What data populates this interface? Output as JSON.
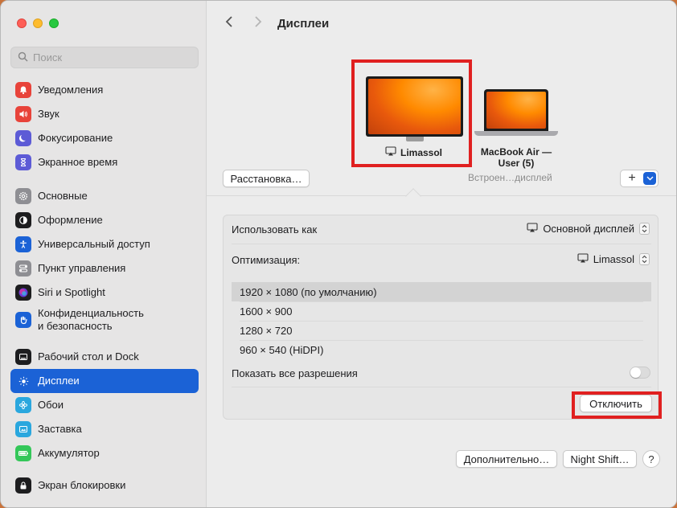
{
  "sidebar": {
    "search_placeholder": "Поиск",
    "groups": [
      [
        {
          "label": "Уведомления",
          "icon": "bell-icon",
          "color": "#e8433a"
        },
        {
          "label": "Звук",
          "icon": "speaker-icon",
          "color": "#e8433a"
        },
        {
          "label": "Фокусирование",
          "icon": "moon-icon",
          "color": "#5d5bd6"
        },
        {
          "label": "Экранное время",
          "icon": "hourglass-icon",
          "color": "#5d5bd6"
        }
      ],
      [
        {
          "label": "Основные",
          "icon": "gear-icon",
          "color": "#8e8e93"
        },
        {
          "label": "Оформление",
          "icon": "appearance-icon",
          "color": "#1d1d1f"
        },
        {
          "label": "Универсальный доступ",
          "icon": "accessibility-icon",
          "color": "#1b62d6"
        },
        {
          "label": "Пункт управления",
          "icon": "control-center-icon",
          "color": "#8e8e93"
        },
        {
          "label": "Siri и Spotlight",
          "icon": "siri-icon",
          "color": "#b03ad6"
        },
        {
          "label": "Конфиденциальность\nи безопасность",
          "icon": "hand-icon",
          "color": "#1b62d6"
        }
      ],
      [
        {
          "label": "Рабочий стол и Dock",
          "icon": "dock-icon",
          "color": "#1d1d1f"
        },
        {
          "label": "Дисплеи",
          "icon": "sun-icon",
          "color": "#1b62d6",
          "active": true
        },
        {
          "label": "Обои",
          "icon": "flower-icon",
          "color": "#2aa7de"
        },
        {
          "label": "Заставка",
          "icon": "screensaver-icon",
          "color": "#2aa7de"
        },
        {
          "label": "Аккумулятор",
          "icon": "battery-icon",
          "color": "#34c759"
        }
      ],
      [
        {
          "label": "Экран блокировки",
          "icon": "lock-icon",
          "color": "#1d1d1f"
        }
      ]
    ]
  },
  "header": {
    "title": "Дисплеи"
  },
  "arrangement": {
    "display1_name": "Limassol",
    "display2_name": "MacBook Air —\nUser (5)",
    "arrange_button": "Расстановка…",
    "builtin_label": "Встроен…дисплей",
    "add_button": "+"
  },
  "settings": {
    "use_as_label": "Использовать как",
    "use_as_value": "Основной дисплей",
    "optimize_label": "Оптимизация:",
    "optimize_value": "Limassol",
    "resolutions": [
      "1920 × 1080 (по умолчанию)",
      "1600 × 900",
      "1280 × 720",
      "960 × 540 (HiDPI)"
    ],
    "selected_resolution_index": 0,
    "show_all_label": "Показать все разрешения",
    "show_all_enabled": false,
    "disconnect_button": "Отключить"
  },
  "footer": {
    "advanced_button": "Дополнительно…",
    "night_shift_button": "Night Shift…",
    "help_button": "?"
  },
  "colors": {
    "accent": "#1b62d6",
    "highlight_frame": "#e02020"
  }
}
